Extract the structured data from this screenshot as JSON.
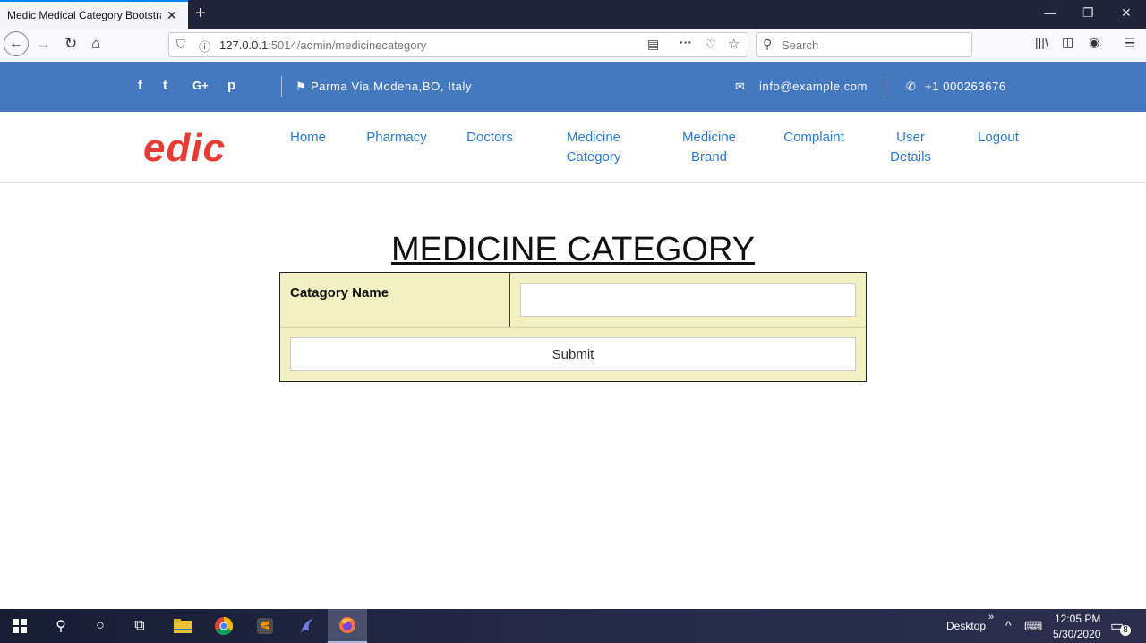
{
  "browser": {
    "tab_title": "Medic Medical Category Bootstrap",
    "tab_close": "✕",
    "new_tab": "+",
    "url_host": "127.0.0.1",
    "url_rest": ":5014/admin/medicinecategory",
    "search_placeholder": "Search"
  },
  "topbar": {
    "social": [
      "f",
      "t",
      "G+",
      "p"
    ],
    "address": "Parma Via Modena,BO, Italy",
    "email": "info@example.com",
    "phone": "+1 000263676"
  },
  "header": {
    "logo": "edic",
    "menu": [
      {
        "line1": "Home",
        "line2": ""
      },
      {
        "line1": "Pharmacy",
        "line2": ""
      },
      {
        "line1": "Doctors",
        "line2": ""
      },
      {
        "line1": "Medicine",
        "line2": "Category"
      },
      {
        "line1": "Medicine",
        "line2": "Brand"
      },
      {
        "line1": "Complaint",
        "line2": ""
      },
      {
        "line1": "User",
        "line2": "Details"
      },
      {
        "line1": "Logout",
        "line2": ""
      }
    ]
  },
  "page": {
    "title": "MEDICINE CATEGORY",
    "field_label": "Catagory Name",
    "field_value": "",
    "submit_label": "Submit"
  },
  "taskbar": {
    "desktop_label": "Desktop",
    "time": "12:05 PM",
    "date": "5/30/2020",
    "notif_count": "8"
  },
  "colors": {
    "top_bar": "#4478bf",
    "logo": "#e63c35",
    "menu_link": "#2a7ad9",
    "form_bg": "#f3f0c4"
  }
}
